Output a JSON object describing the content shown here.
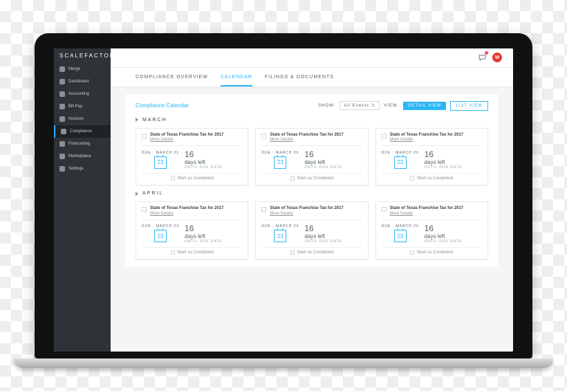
{
  "brand": "SCALEFACTOR",
  "sidebar": {
    "items": [
      {
        "icon": "merge-icon",
        "label": "Merge"
      },
      {
        "icon": "dashboard-icon",
        "label": "Dashboard"
      },
      {
        "icon": "accounting-icon",
        "label": "Accounting"
      },
      {
        "icon": "billpay-icon",
        "label": "Bill Pay"
      },
      {
        "icon": "invoices-icon",
        "label": "Invoices"
      },
      {
        "icon": "compliance-icon",
        "label": "Compliance"
      },
      {
        "icon": "forecasting-icon",
        "label": "Forecasting"
      },
      {
        "icon": "marketplace-icon",
        "label": "Marketplace"
      },
      {
        "icon": "settings-icon",
        "label": "Settings"
      }
    ],
    "active_index": 5
  },
  "topbar": {
    "avatar_initial": "W"
  },
  "tabs": {
    "items": [
      "COMPLIANCE OVERVIEW",
      "CALENDAR",
      "FILINGS & DOCUMENTS"
    ],
    "active_index": 1
  },
  "panel": {
    "title": "Compliance Calendar",
    "show_label": "SHOW:",
    "show_value": "All Events",
    "view_label": "VIEW:",
    "detail_btn": "DETAIL VIEW",
    "list_btn": "LIST VIEW"
  },
  "months": [
    {
      "name": "MARCH",
      "cards": [
        {
          "title": "State of Texas Franchise Tax for 2017",
          "more": "More Details",
          "due_label": "DUE : MARCH 23",
          "day": "23",
          "days_left": "16",
          "days_left_unit": "days left",
          "until": "UNTIL DUE DATE",
          "mark": "Mark as Completed"
        },
        {
          "title": "State of Texas Franchise Tax for 2017",
          "more": "More Details",
          "due_label": "DUE : MARCH 23",
          "day": "23",
          "days_left": "16",
          "days_left_unit": "days left",
          "until": "UNTIL DUE DATE",
          "mark": "Mark as Completed"
        },
        {
          "title": "State of Texas Franchise Tax for 2017",
          "more": "More Details",
          "due_label": "DUE : MARCH 23",
          "day": "23",
          "days_left": "16",
          "days_left_unit": "days left",
          "until": "UNTIL DUE DATE",
          "mark": "Mark as Completed"
        }
      ]
    },
    {
      "name": "APRIL",
      "cards": [
        {
          "title": "State of Texas Franchise Tax for 2017",
          "more": "More Details",
          "due_label": "DUE : MARCH 23",
          "day": "23",
          "days_left": "16",
          "days_left_unit": "days left",
          "until": "UNTIL DUE DATE",
          "mark": "Mark as Completed"
        },
        {
          "title": "State of Texas Franchise Tax for 2017",
          "more": "More Details",
          "due_label": "DUE : MARCH 23",
          "day": "23",
          "days_left": "16",
          "days_left_unit": "days left",
          "until": "UNTIL DUE DATE",
          "mark": "Mark as Completed"
        },
        {
          "title": "State of Texas Franchise Tax for 2017",
          "more": "More Details",
          "due_label": "DUE : MARCH 23",
          "day": "23",
          "days_left": "16",
          "days_left_unit": "days left",
          "until": "UNTIL DUE DATE",
          "mark": "Mark as Completed"
        }
      ]
    }
  ]
}
